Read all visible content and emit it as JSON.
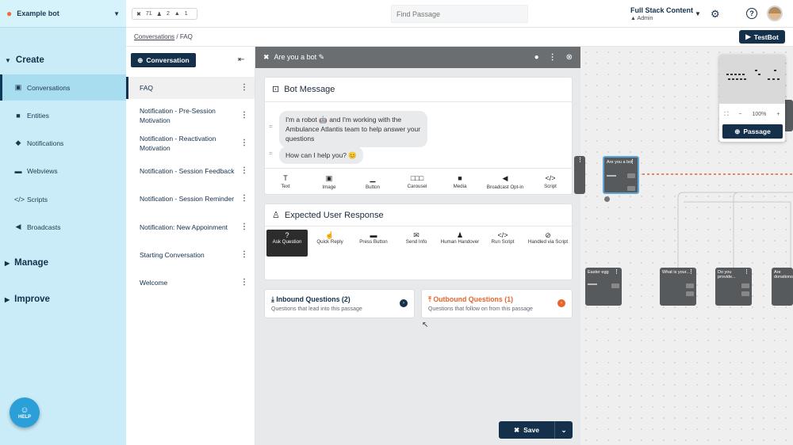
{
  "sidebar": {
    "bot_name": "Example bot",
    "sections": {
      "create": "Create",
      "manage": "Manage",
      "improve": "Improve"
    },
    "items": [
      {
        "label": "Conversations",
        "icon": "chat-icon"
      },
      {
        "label": "Entities",
        "icon": "book-icon"
      },
      {
        "label": "Notifications",
        "icon": "megaphone-icon"
      },
      {
        "label": "Webviews",
        "icon": "window-icon"
      },
      {
        "label": "Scripts",
        "icon": "code-icon"
      },
      {
        "label": "Broadcasts",
        "icon": "bullhorn-icon"
      }
    ],
    "help_label": "HELP"
  },
  "topbar": {
    "stats": {
      "tools": "71",
      "users": "2",
      "locks": "1"
    },
    "search_placeholder": "Find Passage",
    "account_name": "Full Stack Content",
    "account_role": "Admin"
  },
  "breadcrumb": {
    "parent": "Conversations",
    "separator": "/",
    "current": "FAQ"
  },
  "testbot_label": "TestBot",
  "conversation_panel": {
    "new_button": "Conversation",
    "items": [
      "FAQ",
      "Notification - Pre-Session Motivation",
      "Notification - Reactivation Motivation",
      "Notification - Session Feedback",
      "Notification - Session Reminder",
      "Notification: New Appoinment",
      "Starting Conversation",
      "Welcome"
    ]
  },
  "editor": {
    "passage_title": "Are you a bot",
    "bot_message": {
      "title": "Bot Message",
      "bubble1": "I'm a robot 🤖 and I'm working with the Ambulance Atlantis team to help answer your questions",
      "bubble2": "How can I help you? 😊",
      "tools": [
        "Text",
        "Image",
        "Button",
        "Carousel",
        "Media",
        "Broadcast Opt-in",
        "Script"
      ]
    },
    "expected_response": {
      "title": "Expected User Response",
      "options": [
        "Ask Question",
        "Quick Reply",
        "Press Button",
        "Send Info",
        "Human Handover",
        "Run Script",
        "Handled via Script"
      ]
    },
    "inbound": {
      "title": "Inbound Questions (2)",
      "subtitle": "Questions that lead into this passage"
    },
    "outbound": {
      "title": "Outbound Questions (1)",
      "subtitle": "Questions that follow on from this passage"
    },
    "save_label": "Save"
  },
  "canvas": {
    "nodes": [
      "Are you a bot",
      "Easter egg",
      "What is your...",
      "Do you provide...",
      "Are donations..."
    ],
    "zoom_level": "100%",
    "passage_button": "Passage"
  },
  "colors": {
    "navy": "#14304a",
    "sidebar_bg": "#c9ecf8",
    "accent_orange": "#e8642c"
  }
}
